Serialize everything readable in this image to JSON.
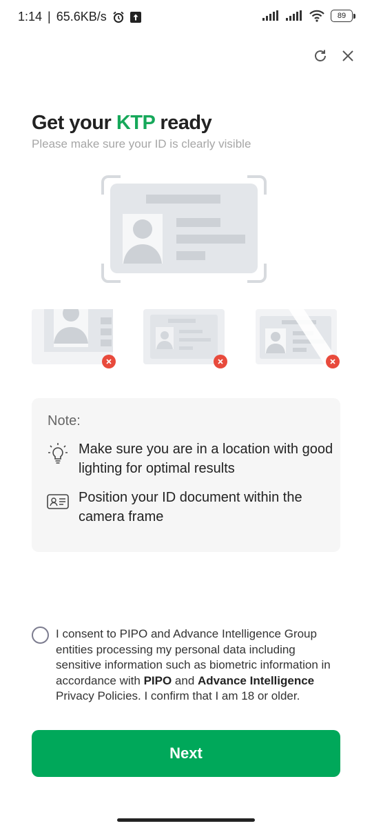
{
  "status_bar": {
    "time": "1:14",
    "speed": "65.6KB/s",
    "battery": "89"
  },
  "header": {
    "title_prefix": "Get your ",
    "title_accent": "KTP",
    "title_suffix": " ready",
    "subtitle": "Please make sure your ID is clearly visible"
  },
  "note": {
    "title": "Note:",
    "items": [
      {
        "icon": "lightbulb-icon",
        "text": "Make sure you are in a location with good lighting for optimal results"
      },
      {
        "icon": "id-card-icon",
        "text": "Position your ID document within the camera frame"
      }
    ]
  },
  "consent": {
    "part1": "I consent to PIPO and Advance Intelligence Group entities processing my personal data including sensitive information such as biometric information in accordance with ",
    "bold1": "PIPO",
    "part2": " and ",
    "bold2": "Advance Intelligence",
    "part3": " Privacy Policies. I confirm that I am 18 or older."
  },
  "actions": {
    "next_label": "Next"
  },
  "colors": {
    "accent": "#16a85a",
    "button": "#00a85a",
    "error": "#e84a3c"
  }
}
